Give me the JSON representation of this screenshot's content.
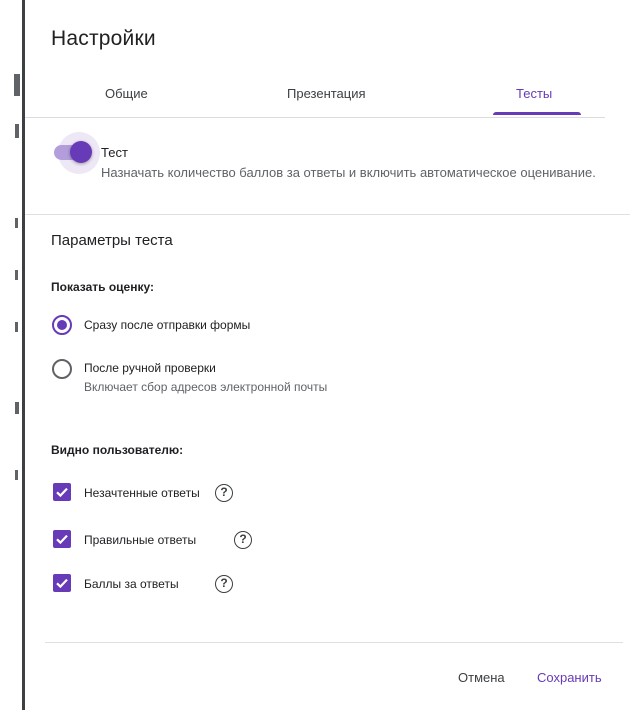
{
  "dialog": {
    "title": "Настройки",
    "tabs": [
      {
        "label": "Общие",
        "active": false
      },
      {
        "label": "Презентация",
        "active": false
      },
      {
        "label": "Тесты",
        "active": true
      }
    ]
  },
  "quiz_toggle": {
    "label": "Тест",
    "description": "Назначать количество баллов за ответы и включить автоматическое оценивание.",
    "enabled": true
  },
  "quiz_options": {
    "section_title": "Параметры теста",
    "release_grade": {
      "heading": "Показать оценку:",
      "options": [
        {
          "label": "Сразу после отправки формы",
          "sublabel": "",
          "selected": true
        },
        {
          "label": "После ручной проверки",
          "sublabel": "Включает сбор адресов электронной почты",
          "selected": false
        }
      ]
    },
    "respondent_can_see": {
      "heading": "Видно пользователю:",
      "items": [
        {
          "label": "Незачтенные ответы",
          "checked": true,
          "help_icon": "?"
        },
        {
          "label": "Правильные ответы",
          "checked": true,
          "help_icon": "?"
        },
        {
          "label": "Баллы за ответы",
          "checked": true,
          "help_icon": "?"
        }
      ]
    }
  },
  "footer": {
    "cancel_label": "Отмена",
    "save_label": "Сохранить"
  },
  "colors": {
    "accent": "#673ab7",
    "accent_light": "#b39ddb",
    "text": "#202124",
    "secondary_text": "#5f6368"
  }
}
